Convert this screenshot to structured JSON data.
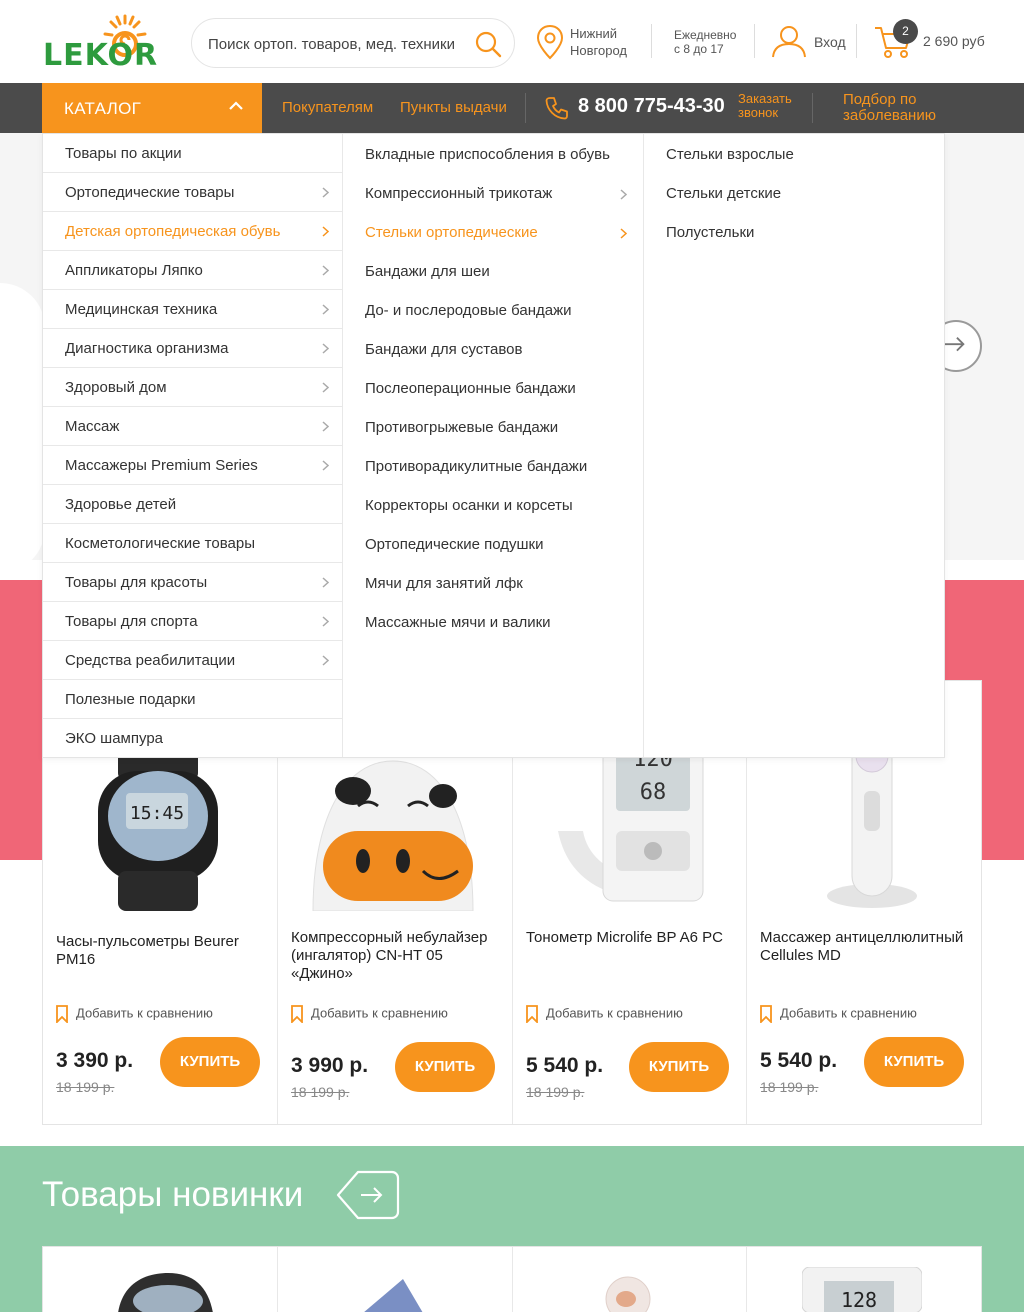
{
  "header": {
    "logo_text": "LEKOR",
    "search_placeholder": "Поиск ортоп. товаров, мед. техники",
    "city_line1": "Нижний",
    "city_line2": "Новгород",
    "hours_line1": "Ежедневно",
    "hours_line2": "с 8 до 17",
    "login": "Вход",
    "cart_count": "2",
    "cart_total": "2 690 руб"
  },
  "nav": {
    "catalog": "КАТАЛОГ",
    "buyers": "Покупателям",
    "pickup": "Пункты выдачи",
    "phone": "8 800 775-43-30",
    "callback_line1": "Заказать",
    "callback_line2": "звонок",
    "disease_line1": "Подбор по",
    "disease_line2": "заболеванию"
  },
  "menu": {
    "col1": [
      {
        "label": "Товары по акции",
        "has_sub": false
      },
      {
        "label": "Ортопедические товары",
        "has_sub": true
      },
      {
        "label": "Детская ортопедическая обувь",
        "has_sub": true,
        "active": true
      },
      {
        "label": "Аппликаторы Ляпко",
        "has_sub": true
      },
      {
        "label": "Медицинская техника",
        "has_sub": true
      },
      {
        "label": "Диагностика организма",
        "has_sub": true
      },
      {
        "label": "Здоровый дом",
        "has_sub": true
      },
      {
        "label": "Массаж",
        "has_sub": true
      },
      {
        "label": "Массажеры Premium Series",
        "has_sub": true
      },
      {
        "label": "Здоровье детей",
        "has_sub": false
      },
      {
        "label": "Косметологические товары",
        "has_sub": false
      },
      {
        "label": "Товары для красоты",
        "has_sub": true
      },
      {
        "label": "Товары для спорта",
        "has_sub": true
      },
      {
        "label": "Средства реабилитации",
        "has_sub": true
      },
      {
        "label": "Полезные подарки",
        "has_sub": false
      },
      {
        "label": "ЭКО шампура",
        "has_sub": false
      }
    ],
    "col2": [
      {
        "label": "Вкладные приспособления в обувь",
        "has_sub": false
      },
      {
        "label": "Компрессионный трикотаж",
        "has_sub": true
      },
      {
        "label": "Стельки ортопедические",
        "has_sub": true,
        "active": true
      },
      {
        "label": "Бандажи для шеи",
        "has_sub": false
      },
      {
        "label": "До- и послеродовые бандажи",
        "has_sub": false
      },
      {
        "label": "Бандажи для суставов",
        "has_sub": false
      },
      {
        "label": "Послеоперационные бандажи",
        "has_sub": false
      },
      {
        "label": "Противогрыжевые бандажи",
        "has_sub": false
      },
      {
        "label": "Противорадикулитные бандажи",
        "has_sub": false
      },
      {
        "label": "Корректоры осанки и корсеты",
        "has_sub": false
      },
      {
        "label": "Ортопедические подушки",
        "has_sub": false
      },
      {
        "label": "Мячи для занятий лфк",
        "has_sub": false
      },
      {
        "label": "Массажные мячи и валики",
        "has_sub": false
      }
    ],
    "col3": [
      {
        "label": "Стельки взрослые"
      },
      {
        "label": "Стельки детские"
      },
      {
        "label": "Полустельки"
      }
    ]
  },
  "products": [
    {
      "title": "Часы-пульсометры Beurer PM16",
      "compare": "Добавить к сравнению",
      "price": "3 390 р.",
      "old_price": "18 199 р.",
      "buy": "КУПИТЬ",
      "icon": "watch-image"
    },
    {
      "title": "Компрессорный небулайзер (ингалятор) CN-HT 05 «Джино»",
      "compare": "Добавить к сравнению",
      "price": "3 990 р.",
      "old_price": "18 199 р.",
      "buy": "КУПИТЬ",
      "icon": "nebulizer-image"
    },
    {
      "title": "Тонометр Microlife BP A6 PC",
      "compare": "Добавить к сравнению",
      "price": "5 540 р.",
      "old_price": "18 199 р.",
      "buy": "КУПИТЬ",
      "icon": "tonometer-image"
    },
    {
      "title": "Массажер антицеллюлитный Cellules MD",
      "compare": "Добавить к сравнению",
      "price": "5 540 р.",
      "old_price": "18 199 р.",
      "buy": "КУПИТЬ",
      "icon": "massager-image"
    }
  ],
  "new_section": {
    "title": "Товары новинки"
  },
  "colors": {
    "accent": "#f7941d",
    "nav_bg": "#4b4b4b",
    "pink": "#f06677",
    "green": "#8fcca8",
    "logo_green": "#2e9b3e"
  }
}
